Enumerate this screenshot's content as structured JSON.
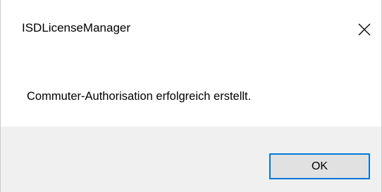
{
  "window": {
    "title": "ISDLicenseManager",
    "close_icon": "close-icon"
  },
  "content": {
    "message": "Commuter-Authorisation erfolgreich erstellt."
  },
  "footer": {
    "ok_label": "OK"
  },
  "colors": {
    "accent": "#0078d7",
    "footer_background": "#f0f0f0",
    "button_background": "#e1e1e1"
  }
}
